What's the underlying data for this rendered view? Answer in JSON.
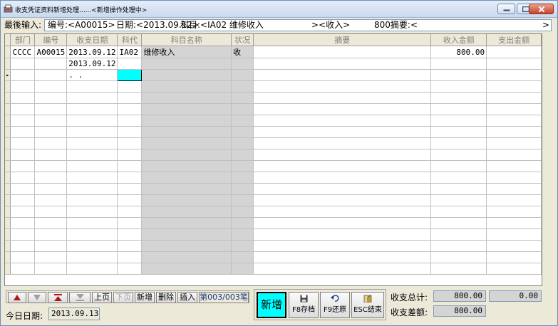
{
  "window": {
    "title": "收支凭证资料新增处理......<新增操作处理中>"
  },
  "last_input": {
    "label": "最後输入:",
    "code": "编号:<A00015>",
    "date": "日期:<2013.09.12>",
    "subject": "科目:<IA02 维修收入",
    "kind": "><收入>",
    "amount": "800摘要:<",
    "tail": ">"
  },
  "grid": {
    "columns": [
      "部门",
      "编号",
      "收支日期",
      "科代",
      "科目名称",
      "状况",
      "摘要",
      "收入金额",
      "支出金额"
    ],
    "rows": [
      {
        "dept": "CCCC",
        "code": "A00015",
        "date": "2013.09.12",
        "subj_code": "IA02",
        "subj_name": "维修收入",
        "status": "收",
        "memo": "",
        "income": "800.00",
        "expense": ""
      },
      {
        "dept": "",
        "code": "",
        "date": "2013.09.12",
        "subj_code": "",
        "subj_name": "",
        "status": "",
        "memo": "",
        "income": "",
        "expense": ""
      },
      {
        "dept": "",
        "code": "",
        "date": ".  .",
        "subj_code": "",
        "subj_name": "",
        "status": "",
        "memo": "",
        "income": "",
        "expense": ""
      }
    ]
  },
  "nav": {
    "prev_page": "上页",
    "next_page": "下页",
    "add": "新增",
    "delete": "删除",
    "insert": "插入",
    "page_info": "第003/003笔"
  },
  "today": {
    "label": "今日日期:",
    "value": "2013.09.13"
  },
  "actions": {
    "new": "新增",
    "save": "F8存档",
    "restore": "F9还原",
    "exit": "ESC结束"
  },
  "totals": {
    "sum_label": "收支总计:",
    "sum_income": "800.00",
    "sum_expense": "0.00",
    "diff_label": "收支差额:",
    "diff_value": "800.00"
  },
  "colors": {
    "selected_cell": "#00ffff",
    "grey_column": "#d4d4d4"
  }
}
